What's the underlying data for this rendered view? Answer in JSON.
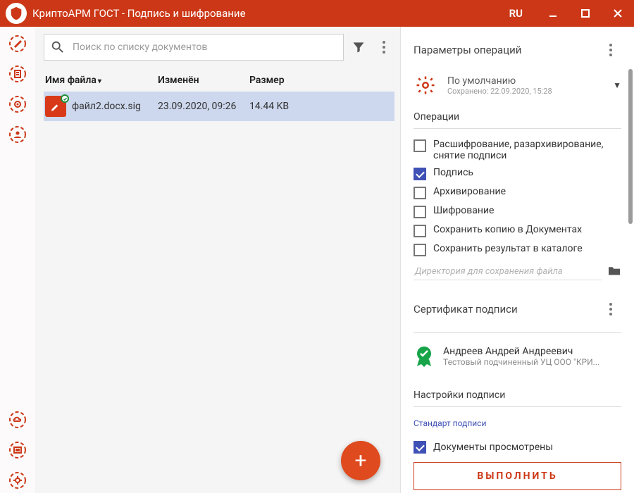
{
  "window": {
    "title": "КриптоАРМ ГОСТ - Подпись и шифрование",
    "lang": "RU"
  },
  "search": {
    "placeholder": "Поиск по списку документов"
  },
  "columns": {
    "name": "Имя файла",
    "modified": "Изменён",
    "size": "Размер"
  },
  "files": [
    {
      "name": "файл2.docx.sig",
      "modified": "23.09.2020, 09:26",
      "size": "14.44 KB"
    }
  ],
  "params": {
    "header": "Параметры операций",
    "profile_name": "По умолчанию",
    "profile_saved": "Сохранено: 22.09.2020, 15:28"
  },
  "ops": {
    "header": "Операции",
    "items": [
      {
        "label": "Расшифрование, разархивирование, снятие подписи",
        "checked": false
      },
      {
        "label": "Подпись",
        "checked": true
      },
      {
        "label": "Архивирование",
        "checked": false
      },
      {
        "label": "Шифрование",
        "checked": false
      },
      {
        "label": "Сохранить копию в Документах",
        "checked": false
      },
      {
        "label": "Сохранить результат в каталоге",
        "checked": false
      }
    ],
    "dir_placeholder": "Директория для сохранения файла"
  },
  "cert": {
    "header": "Сертификат подписи",
    "name": "Андреев Андрей Андреевич",
    "issuer": "Тестовый подчиненный УЦ ООО \"КРИ..."
  },
  "sign_settings": {
    "header": "Настройки подписи",
    "standard": "Стандарт подписи"
  },
  "docs_viewed": "Документы просмотрены",
  "execute": "ВЫПОЛНИТЬ"
}
